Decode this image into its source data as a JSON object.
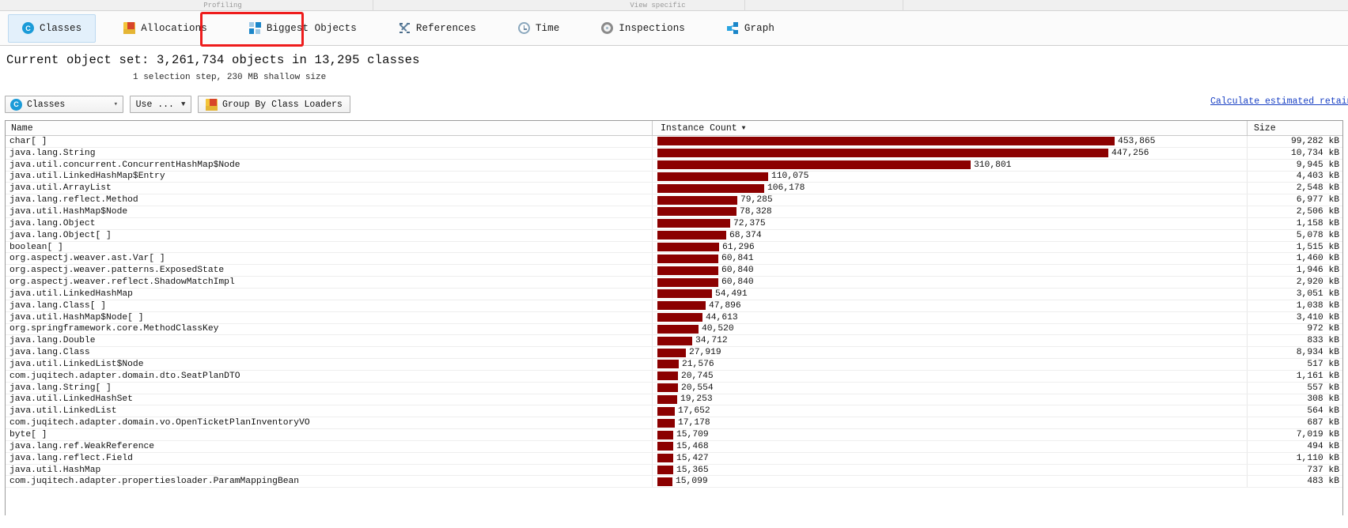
{
  "menu": {
    "segments": [
      "",
      "Profiling",
      "",
      "View specific",
      "",
      "",
      ""
    ]
  },
  "tabs": [
    {
      "label": "Classes",
      "icon": "classes-icon",
      "selected": true
    },
    {
      "label": "Allocations",
      "icon": "allocations-icon",
      "selected": false
    },
    {
      "label": "Biggest Objects",
      "icon": "biggest-objects-icon",
      "selected": false
    },
    {
      "label": "References",
      "icon": "references-icon",
      "selected": false
    },
    {
      "label": "Time",
      "icon": "time-icon",
      "selected": false
    },
    {
      "label": "Inspections",
      "icon": "inspections-icon",
      "selected": false
    },
    {
      "label": "Graph",
      "icon": "graph-icon",
      "selected": false
    }
  ],
  "summary": {
    "headline": "Current object set: 3,261,734 objects in 13,295 classes",
    "subline": "1 selection step, 230 MB shallow size"
  },
  "filterbar": {
    "view_combo": "Classes",
    "use_button": "Use ...",
    "group_button": "Group By Class Loaders",
    "retained_link": "Calculate estimated retained si"
  },
  "table": {
    "columns": [
      "Name",
      "Instance Count",
      "Size"
    ],
    "sorted_column": "Instance Count",
    "bar_color": "#8b0000",
    "max_count": 453865,
    "rows": [
      {
        "name": "char[ ]",
        "count": "453,865",
        "count_value": 453865,
        "size": "99,282 kB"
      },
      {
        "name": "java.lang.String",
        "count": "447,256",
        "count_value": 447256,
        "size": "10,734 kB"
      },
      {
        "name": "java.util.concurrent.ConcurrentHashMap$Node",
        "count": "310,801",
        "count_value": 310801,
        "size": "9,945 kB"
      },
      {
        "name": "java.util.LinkedHashMap$Entry",
        "count": "110,075",
        "count_value": 110075,
        "size": "4,403 kB"
      },
      {
        "name": "java.util.ArrayList",
        "count": "106,178",
        "count_value": 106178,
        "size": "2,548 kB"
      },
      {
        "name": "java.lang.reflect.Method",
        "count": "79,285",
        "count_value": 79285,
        "size": "6,977 kB"
      },
      {
        "name": "java.util.HashMap$Node",
        "count": "78,328",
        "count_value": 78328,
        "size": "2,506 kB"
      },
      {
        "name": "java.lang.Object",
        "count": "72,375",
        "count_value": 72375,
        "size": "1,158 kB"
      },
      {
        "name": "java.lang.Object[ ]",
        "count": "68,374",
        "count_value": 68374,
        "size": "5,078 kB"
      },
      {
        "name": "boolean[ ]",
        "count": "61,296",
        "count_value": 61296,
        "size": "1,515 kB"
      },
      {
        "name": "org.aspectj.weaver.ast.Var[ ]",
        "count": "60,841",
        "count_value": 60841,
        "size": "1,460 kB"
      },
      {
        "name": "org.aspectj.weaver.patterns.ExposedState",
        "count": "60,840",
        "count_value": 60840,
        "size": "1,946 kB"
      },
      {
        "name": "org.aspectj.weaver.reflect.ShadowMatchImpl",
        "count": "60,840",
        "count_value": 60840,
        "size": "2,920 kB"
      },
      {
        "name": "java.util.LinkedHashMap",
        "count": "54,491",
        "count_value": 54491,
        "size": "3,051 kB"
      },
      {
        "name": "java.lang.Class[ ]",
        "count": "47,896",
        "count_value": 47896,
        "size": "1,038 kB"
      },
      {
        "name": "java.util.HashMap$Node[ ]",
        "count": "44,613",
        "count_value": 44613,
        "size": "3,410 kB"
      },
      {
        "name": "org.springframework.core.MethodClassKey",
        "count": "40,520",
        "count_value": 40520,
        "size": "972 kB"
      },
      {
        "name": "java.lang.Double",
        "count": "34,712",
        "count_value": 34712,
        "size": "833 kB"
      },
      {
        "name": "java.lang.Class",
        "count": "27,919",
        "count_value": 27919,
        "size": "8,934 kB"
      },
      {
        "name": "java.util.LinkedList$Node",
        "count": "21,576",
        "count_value": 21576,
        "size": "517 kB"
      },
      {
        "name": "com.juqitech.adapter.domain.dto.SeatPlanDTO",
        "count": "20,745",
        "count_value": 20745,
        "size": "1,161 kB"
      },
      {
        "name": "java.lang.String[ ]",
        "count": "20,554",
        "count_value": 20554,
        "size": "557 kB"
      },
      {
        "name": "java.util.LinkedHashSet",
        "count": "19,253",
        "count_value": 19253,
        "size": "308 kB"
      },
      {
        "name": "java.util.LinkedList",
        "count": "17,652",
        "count_value": 17652,
        "size": "564 kB"
      },
      {
        "name": "com.juqitech.adapter.domain.vo.OpenTicketPlanInventoryVO",
        "count": "17,178",
        "count_value": 17178,
        "size": "687 kB"
      },
      {
        "name": "byte[ ]",
        "count": "15,709",
        "count_value": 15709,
        "size": "7,019 kB"
      },
      {
        "name": "java.lang.ref.WeakReference",
        "count": "15,468",
        "count_value": 15468,
        "size": "494 kB"
      },
      {
        "name": "java.lang.reflect.Field",
        "count": "15,427",
        "count_value": 15427,
        "size": "1,110 kB"
      },
      {
        "name": "java.util.HashMap",
        "count": "15,365",
        "count_value": 15365,
        "size": "737 kB"
      },
      {
        "name": "com.juqitech.adapter.propertiesloader.ParamMappingBean",
        "count": "15,099",
        "count_value": 15099,
        "size": "483 kB"
      }
    ]
  }
}
